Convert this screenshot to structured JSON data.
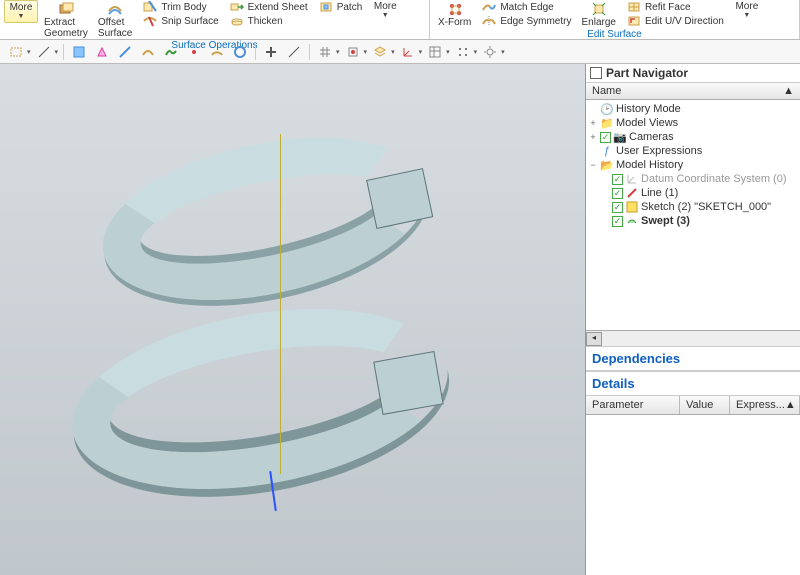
{
  "ribbon": {
    "group1": {
      "label": "Surface Operations",
      "more": "More",
      "extract_geom": "Extract\nGeometry",
      "offset_surf": "Offset\nSurface",
      "trim_body": "Trim Body",
      "extend_sheet": "Extend Sheet",
      "snip_surface": "Snip Surface",
      "patch": "Patch",
      "thicken": "Thicken",
      "more2": "More"
    },
    "group2": {
      "label": "Edit Surface",
      "xform": "X-Form",
      "match_edge": "Match Edge",
      "edge_sym": "Edge Symmetry",
      "enlarge": "Enlarge",
      "refit_face": "Refit Face",
      "edit_uv": "Edit U/V Direction",
      "more": "More"
    }
  },
  "navigator": {
    "title": "Part Navigator",
    "name_col": "Name",
    "history_mode": "History Mode",
    "model_views": "Model Views",
    "cameras": "Cameras",
    "user_expr": "User Expressions",
    "model_history": "Model History",
    "datum": "Datum Coordinate System (0)",
    "line": "Line (1)",
    "sketch": "Sketch (2) \"SKETCH_000\"",
    "swept": "Swept (3)"
  },
  "panels": {
    "dependencies": "Dependencies",
    "details": "Details",
    "p_col": "Parameter",
    "v_col": "Value",
    "e_col": "Express..."
  }
}
